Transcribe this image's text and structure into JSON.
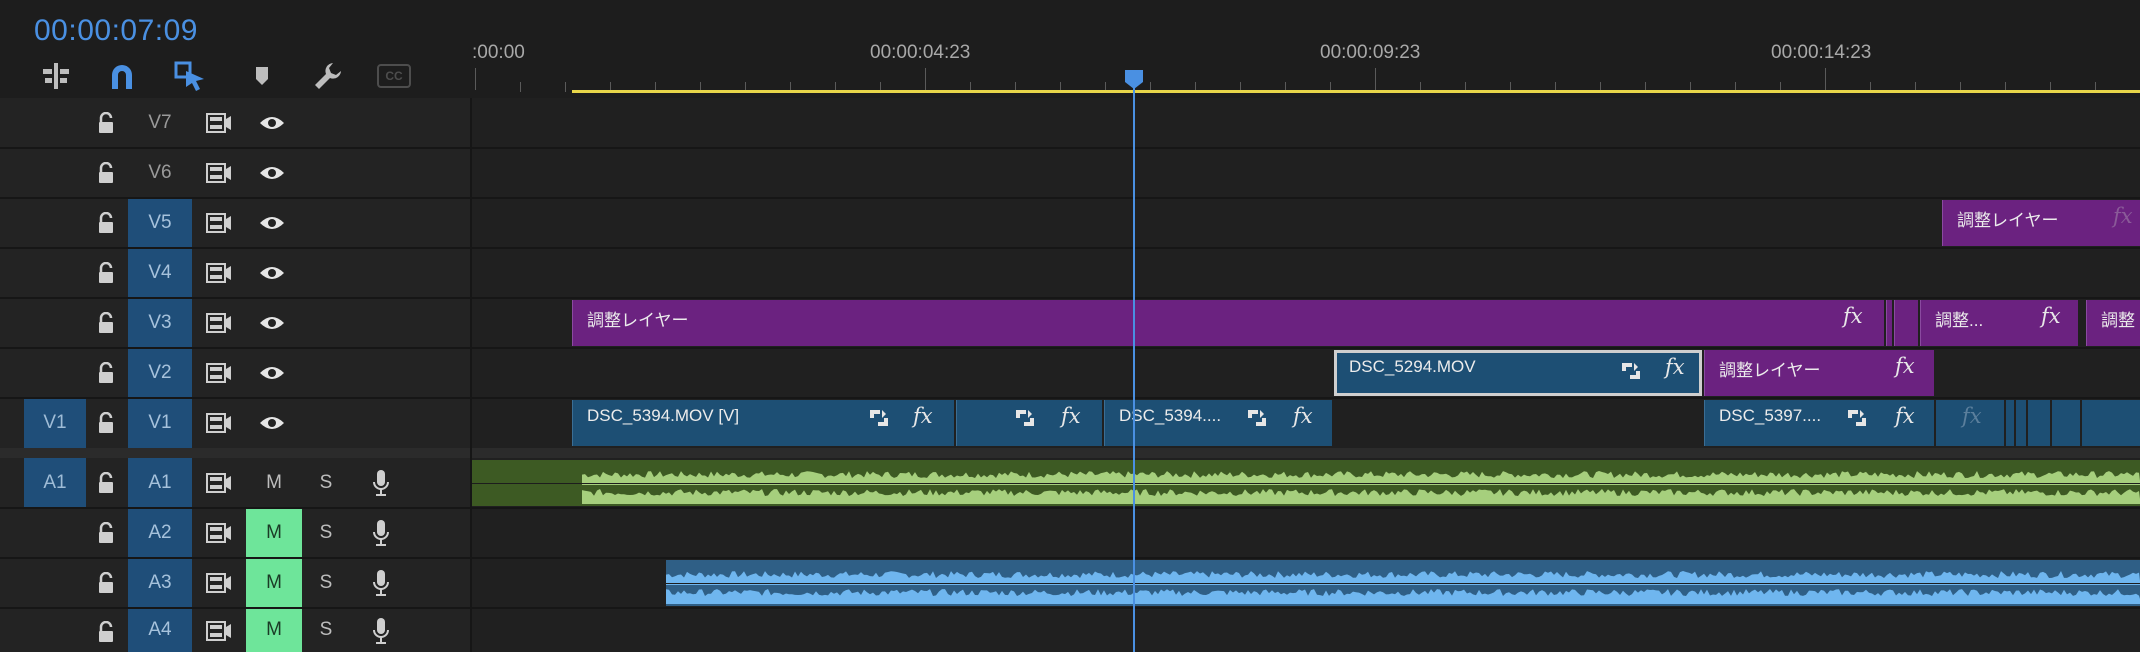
{
  "timecode": "00:00:07:09",
  "ruler": {
    "labels": [
      ":00:00",
      "00:00:04:23",
      "00:00:09:23",
      "00:00:14:23"
    ]
  },
  "toolbar": {
    "icons": [
      "insert-sequence-nest-icon",
      "snap-magnet-icon",
      "linked-selection-icon",
      "add-marker-icon",
      "timeline-settings-wrench-icon",
      "captions-icon"
    ],
    "captions_text": "CC"
  },
  "tracks": {
    "video": [
      {
        "name": "V7",
        "target": false,
        "source": ""
      },
      {
        "name": "V6",
        "target": false,
        "source": ""
      },
      {
        "name": "V5",
        "target": true,
        "source": ""
      },
      {
        "name": "V4",
        "target": true,
        "source": ""
      },
      {
        "name": "V3",
        "target": true,
        "source": ""
      },
      {
        "name": "V2",
        "target": true,
        "source": ""
      },
      {
        "name": "V1",
        "target": true,
        "source": "V1"
      }
    ],
    "audio": [
      {
        "name": "A1",
        "target": true,
        "source": "A1",
        "mute": false,
        "mute_label": "M",
        "solo_label": "S"
      },
      {
        "name": "A2",
        "target": true,
        "source": "",
        "mute": true,
        "mute_label": "M",
        "solo_label": "S"
      },
      {
        "name": "A3",
        "target": true,
        "source": "",
        "mute": true,
        "mute_label": "M",
        "solo_label": "S"
      },
      {
        "name": "A4",
        "target": true,
        "source": "",
        "mute": true,
        "mute_label": "M",
        "solo_label": "S"
      }
    ]
  },
  "clips": {
    "v5_adjust": "調整レイヤー",
    "v3_adjust_long": "調整レイヤー",
    "v3_adjust_short": "調整...",
    "v3_adjust_end": "調整",
    "v2_dsc5294": "DSC_5294.MOV",
    "v2_adjust": "調整レイヤー",
    "v1_dsc5394": "DSC_5394.MOV [V]",
    "v1_dsc5394b": "DSC_5394....",
    "v1_dsc5397": "DSC_5397....",
    "fx": "fx"
  },
  "colors": {
    "accent": "#4a90e2",
    "adjustment_layer": "#6b2280",
    "video_clip": "#1d4f74",
    "audio_a1": "#3d5a23",
    "audio_a1_wave": "#a6cf7d",
    "audio_a3_wave": "#6fb6ef",
    "mute_on": "#6ee59a",
    "work_area_bar": "#e8d64a"
  }
}
